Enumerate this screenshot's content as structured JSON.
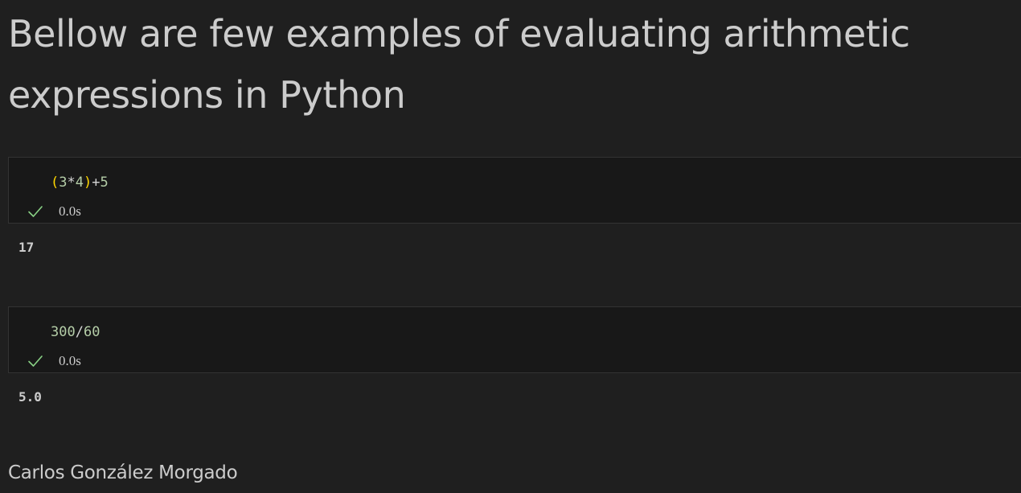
{
  "heading": {
    "line1": "Bellow are few examples of evaluating arithmetic",
    "line2": "expressions in Python"
  },
  "cells": [
    {
      "code_parts": [
        "(",
        "3",
        "*",
        "4",
        ")",
        "+",
        "5"
      ],
      "status_icon": "check-icon",
      "exec_time": "0.0s",
      "output": "17"
    },
    {
      "code_parts": [
        "300",
        "/",
        "60"
      ],
      "status_icon": "check-icon",
      "exec_time": "0.0s",
      "output": "5.0"
    }
  ],
  "author": "Carlos González Morgado",
  "colors": {
    "background": "#1f1f1f",
    "cell_background": "#181818",
    "number": "#b5cea8",
    "bracket": "#ffd700",
    "success": "#89d185"
  }
}
